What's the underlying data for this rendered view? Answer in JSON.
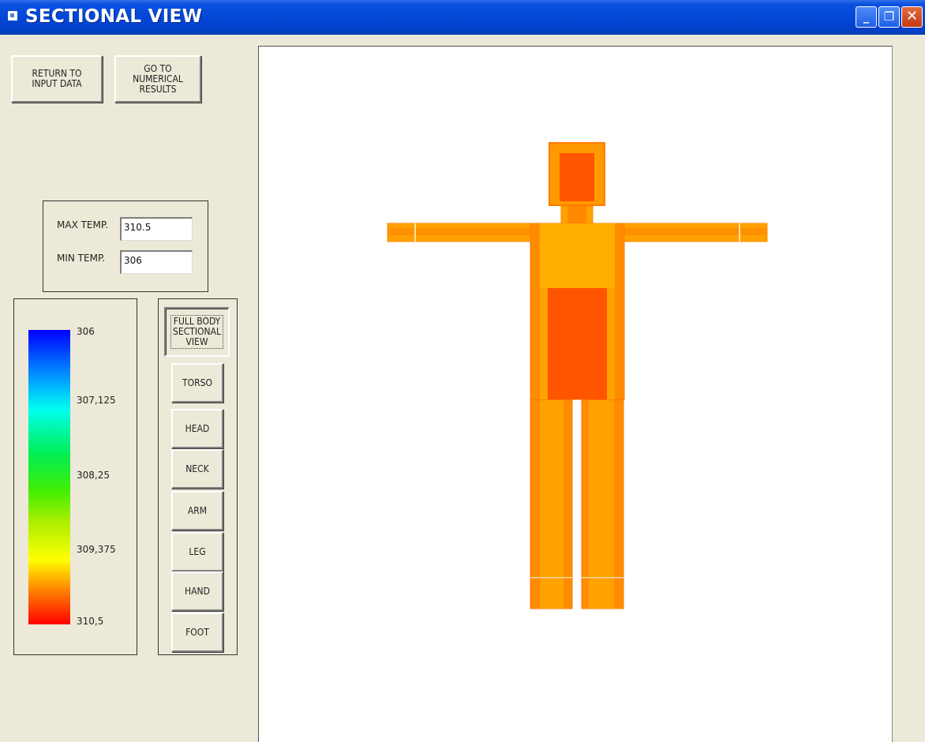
{
  "window": {
    "title": "SECTIONAL VIEW",
    "minimize": "_",
    "restore": "❐",
    "close": "✕"
  },
  "nav": {
    "return_label": "RETURN TO\nINPUT DATA",
    "numerical_label": "GO TO\nNUMERICAL\nRESULTS"
  },
  "temps": {
    "max_label": "MAX TEMP.",
    "max_value": "310.5",
    "min_label": "MIN TEMP.",
    "min_value": "306"
  },
  "legend": {
    "ticks": [
      "306",
      "307,125",
      "308,25",
      "309,375",
      "310,5"
    ],
    "colors": [
      "#0000ff",
      "#00aaff",
      "#00ffee",
      "#00ee55",
      "#aaee00",
      "#ffff00",
      "#ff8800",
      "#ff0000"
    ]
  },
  "views": {
    "full_body": "FULL BODY\nSECTIONAL\nVIEW",
    "buttons": [
      "TORSO",
      "HEAD",
      "NECK",
      "ARM",
      "LEG",
      "HAND",
      "FOOT"
    ]
  },
  "body_colors": {
    "outer": "#ff8c00",
    "mid": "#ffa200",
    "core": "#ff5500",
    "light": "#ffae00"
  }
}
